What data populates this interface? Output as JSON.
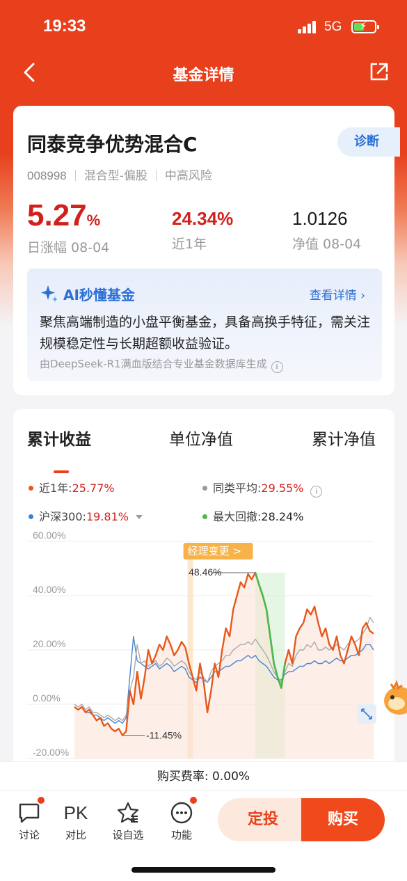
{
  "status": {
    "time": "19:33",
    "network": "5G"
  },
  "nav": {
    "title": "基金详情"
  },
  "fund": {
    "name": "同泰竞争优势混合C",
    "diagnose_label": "诊断",
    "code": "008998",
    "type": "混合型-偏股",
    "risk": "中高风险",
    "daily_change_value": "5.27",
    "daily_change_unit": "%",
    "daily_change_label": "日涨幅 08-04",
    "one_year_value": "24.34%",
    "one_year_label": "近1年",
    "nav_value": "1.0126",
    "nav_label": "净值 08-04"
  },
  "ai": {
    "title": "AI秒懂基金",
    "more": "查看详情 ›",
    "summary": "聚焦高端制造的小盘平衡基金，具备高换手特征，需关注规模稳定性与长期超额收益验证。",
    "footer": "由DeepSeek-R1满血版结合专业基金数据库生成",
    "info_glyph": "i"
  },
  "tabs": [
    "累计收益",
    "单位净值",
    "累计净值"
  ],
  "legend": [
    {
      "label": "近1年:",
      "value": "25.77%",
      "color": "#e8581c"
    },
    {
      "label": "同类平均:",
      "value": "29.55%",
      "color": "#999999"
    },
    {
      "label": "沪深300:",
      "value": "19.81%",
      "color": "#3d7fd6"
    },
    {
      "label": "最大回撤:",
      "value": "28.24%",
      "color": "#4cb84c"
    }
  ],
  "chart_data": {
    "type": "line",
    "y_ticks": [
      "60.00%",
      "40.00%",
      "20.00%",
      "0.00%",
      "-20.00%"
    ],
    "ylim": [
      -20,
      60
    ],
    "annotations": {
      "manager_change": "经理变更 >",
      "max_label": "48.46%",
      "min_label": "-11.45%"
    },
    "series": [
      {
        "name": "近1年",
        "color": "#e8581c",
        "values": [
          -1,
          -2,
          -1,
          -3,
          -2,
          -4,
          -6,
          -5,
          -8,
          -7,
          -9,
          -10,
          -9,
          -11.45,
          -10,
          5,
          0,
          12,
          2,
          10,
          20,
          15,
          18,
          22,
          20,
          25,
          22,
          18,
          20,
          23,
          21,
          15,
          10,
          5,
          15,
          8,
          -3,
          5,
          15,
          10,
          20,
          28,
          25,
          35,
          40,
          45,
          43,
          48,
          46,
          48.46,
          44,
          40,
          35,
          25,
          15,
          10,
          6,
          15,
          20,
          15,
          25,
          28,
          30,
          35,
          33,
          36,
          30,
          25,
          28,
          22,
          20,
          25,
          18,
          15,
          20,
          25,
          22,
          18,
          28,
          30,
          27,
          26
        ]
      },
      {
        "name": "同类平均",
        "color": "#aaaaaa",
        "values": [
          0,
          -1,
          0,
          -2,
          -1,
          -3,
          -3,
          -4,
          -5,
          -4,
          -5,
          -6,
          -5,
          -6,
          -4,
          5,
          10,
          22,
          15,
          16,
          14,
          15,
          16,
          14,
          15,
          17,
          16,
          14,
          15,
          16,
          15,
          12,
          10,
          9,
          12,
          10,
          8,
          12,
          14,
          15,
          16,
          18,
          18,
          20,
          21,
          22,
          22,
          23,
          22,
          24,
          22,
          20,
          18,
          15,
          12,
          10,
          8,
          12,
          15,
          14,
          18,
          20,
          20,
          22,
          21,
          23,
          20,
          20,
          21,
          20,
          21,
          22,
          21,
          20,
          22,
          24,
          23,
          24,
          26,
          28,
          32,
          30
        ]
      },
      {
        "name": "沪深300",
        "color": "#4a86d4",
        "values": [
          -1,
          -2,
          -1,
          -3,
          -3,
          -4,
          -4,
          -5,
          -6,
          -5,
          -6,
          -7,
          -6,
          -7,
          -5,
          10,
          25,
          16,
          15,
          14,
          13,
          14,
          15,
          13,
          14,
          15,
          14,
          12,
          13,
          14,
          13,
          10,
          9,
          8,
          10,
          9,
          8,
          10,
          12,
          12,
          13,
          14,
          14,
          15,
          16,
          16,
          17,
          18,
          17,
          18,
          16,
          15,
          14,
          12,
          10,
          9,
          9,
          11,
          12,
          12,
          13,
          14,
          14,
          15,
          15,
          16,
          15,
          15,
          16,
          15,
          16,
          17,
          16,
          16,
          17,
          18,
          18,
          19,
          20,
          22,
          22,
          20
        ]
      }
    ]
  },
  "fee": {
    "text": "购买费率: 0.00%"
  },
  "bottom": {
    "items": [
      {
        "label": "讨论",
        "icon_text": ""
      },
      {
        "label": "对比",
        "icon_text": "PK"
      },
      {
        "label": "设自选",
        "icon_text": ""
      },
      {
        "label": "功能",
        "icon_text": ""
      }
    ],
    "dingtou": "定投",
    "buy": "购买"
  }
}
